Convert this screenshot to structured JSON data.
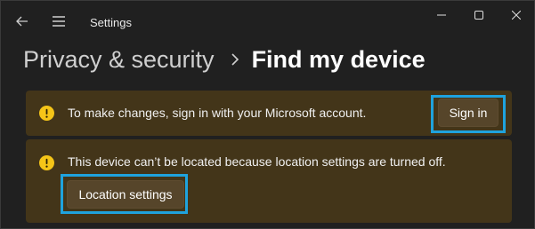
{
  "window": {
    "app_title": "Settings"
  },
  "breadcrumb": {
    "parent": "Privacy & security",
    "separator": "›",
    "current": "Find my device"
  },
  "banners": [
    {
      "text": "To make changes, sign in with your Microsoft account.",
      "button_label": "Sign in"
    },
    {
      "text": "This device can’t be located because location settings are turned off.",
      "button_label": "Location settings"
    }
  ],
  "icons": {
    "back": "back-arrow-icon",
    "menu": "hamburger-menu-icon",
    "warning": "warning-icon",
    "minimize": "minimize-icon",
    "maximize": "maximize-icon",
    "close": "close-icon"
  },
  "colors": {
    "background": "#202020",
    "banner": "#433519",
    "button": "#56452a",
    "warning": "#f5c518",
    "highlight": "#1fa3dd"
  }
}
